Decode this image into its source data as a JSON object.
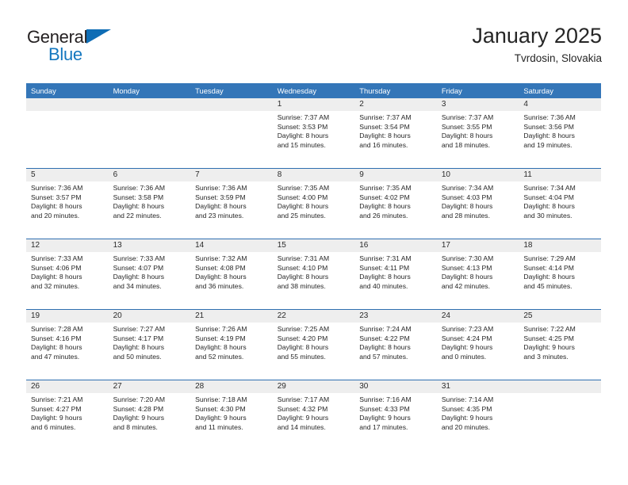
{
  "brand": {
    "name_top": "General",
    "name_bottom": "Blue",
    "triangle_color": "#0f6db5",
    "text_color_top": "#231f20",
    "text_color_bottom": "#1477bf"
  },
  "header": {
    "title": "January 2025",
    "subtitle": "Tvrdosin, Slovakia"
  },
  "theme": {
    "header_blue": "#3476b8",
    "separator_blue": "#2f6fb0",
    "date_band_gray": "#eeeeee",
    "text_dark": "#262626"
  },
  "weekdays": [
    "Sunday",
    "Monday",
    "Tuesday",
    "Wednesday",
    "Thursday",
    "Friday",
    "Saturday"
  ],
  "weeks": [
    {
      "days": [
        {
          "num": "",
          "sunrise": "",
          "sunset": "",
          "daylight_l1": "",
          "daylight_l2": "",
          "empty": true
        },
        {
          "num": "",
          "sunrise": "",
          "sunset": "",
          "daylight_l1": "",
          "daylight_l2": "",
          "empty": true
        },
        {
          "num": "",
          "sunrise": "",
          "sunset": "",
          "daylight_l1": "",
          "daylight_l2": "",
          "empty": true
        },
        {
          "num": "1",
          "sunrise": "Sunrise: 7:37 AM",
          "sunset": "Sunset: 3:53 PM",
          "daylight_l1": "Daylight: 8 hours",
          "daylight_l2": "and 15 minutes.",
          "empty": false
        },
        {
          "num": "2",
          "sunrise": "Sunrise: 7:37 AM",
          "sunset": "Sunset: 3:54 PM",
          "daylight_l1": "Daylight: 8 hours",
          "daylight_l2": "and 16 minutes.",
          "empty": false
        },
        {
          "num": "3",
          "sunrise": "Sunrise: 7:37 AM",
          "sunset": "Sunset: 3:55 PM",
          "daylight_l1": "Daylight: 8 hours",
          "daylight_l2": "and 18 minutes.",
          "empty": false
        },
        {
          "num": "4",
          "sunrise": "Sunrise: 7:36 AM",
          "sunset": "Sunset: 3:56 PM",
          "daylight_l1": "Daylight: 8 hours",
          "daylight_l2": "and 19 minutes.",
          "empty": false
        }
      ]
    },
    {
      "days": [
        {
          "num": "5",
          "sunrise": "Sunrise: 7:36 AM",
          "sunset": "Sunset: 3:57 PM",
          "daylight_l1": "Daylight: 8 hours",
          "daylight_l2": "and 20 minutes.",
          "empty": false
        },
        {
          "num": "6",
          "sunrise": "Sunrise: 7:36 AM",
          "sunset": "Sunset: 3:58 PM",
          "daylight_l1": "Daylight: 8 hours",
          "daylight_l2": "and 22 minutes.",
          "empty": false
        },
        {
          "num": "7",
          "sunrise": "Sunrise: 7:36 AM",
          "sunset": "Sunset: 3:59 PM",
          "daylight_l1": "Daylight: 8 hours",
          "daylight_l2": "and 23 minutes.",
          "empty": false
        },
        {
          "num": "8",
          "sunrise": "Sunrise: 7:35 AM",
          "sunset": "Sunset: 4:00 PM",
          "daylight_l1": "Daylight: 8 hours",
          "daylight_l2": "and 25 minutes.",
          "empty": false
        },
        {
          "num": "9",
          "sunrise": "Sunrise: 7:35 AM",
          "sunset": "Sunset: 4:02 PM",
          "daylight_l1": "Daylight: 8 hours",
          "daylight_l2": "and 26 minutes.",
          "empty": false
        },
        {
          "num": "10",
          "sunrise": "Sunrise: 7:34 AM",
          "sunset": "Sunset: 4:03 PM",
          "daylight_l1": "Daylight: 8 hours",
          "daylight_l2": "and 28 minutes.",
          "empty": false
        },
        {
          "num": "11",
          "sunrise": "Sunrise: 7:34 AM",
          "sunset": "Sunset: 4:04 PM",
          "daylight_l1": "Daylight: 8 hours",
          "daylight_l2": "and 30 minutes.",
          "empty": false
        }
      ]
    },
    {
      "days": [
        {
          "num": "12",
          "sunrise": "Sunrise: 7:33 AM",
          "sunset": "Sunset: 4:06 PM",
          "daylight_l1": "Daylight: 8 hours",
          "daylight_l2": "and 32 minutes.",
          "empty": false
        },
        {
          "num": "13",
          "sunrise": "Sunrise: 7:33 AM",
          "sunset": "Sunset: 4:07 PM",
          "daylight_l1": "Daylight: 8 hours",
          "daylight_l2": "and 34 minutes.",
          "empty": false
        },
        {
          "num": "14",
          "sunrise": "Sunrise: 7:32 AM",
          "sunset": "Sunset: 4:08 PM",
          "daylight_l1": "Daylight: 8 hours",
          "daylight_l2": "and 36 minutes.",
          "empty": false
        },
        {
          "num": "15",
          "sunrise": "Sunrise: 7:31 AM",
          "sunset": "Sunset: 4:10 PM",
          "daylight_l1": "Daylight: 8 hours",
          "daylight_l2": "and 38 minutes.",
          "empty": false
        },
        {
          "num": "16",
          "sunrise": "Sunrise: 7:31 AM",
          "sunset": "Sunset: 4:11 PM",
          "daylight_l1": "Daylight: 8 hours",
          "daylight_l2": "and 40 minutes.",
          "empty": false
        },
        {
          "num": "17",
          "sunrise": "Sunrise: 7:30 AM",
          "sunset": "Sunset: 4:13 PM",
          "daylight_l1": "Daylight: 8 hours",
          "daylight_l2": "and 42 minutes.",
          "empty": false
        },
        {
          "num": "18",
          "sunrise": "Sunrise: 7:29 AM",
          "sunset": "Sunset: 4:14 PM",
          "daylight_l1": "Daylight: 8 hours",
          "daylight_l2": "and 45 minutes.",
          "empty": false
        }
      ]
    },
    {
      "days": [
        {
          "num": "19",
          "sunrise": "Sunrise: 7:28 AM",
          "sunset": "Sunset: 4:16 PM",
          "daylight_l1": "Daylight: 8 hours",
          "daylight_l2": "and 47 minutes.",
          "empty": false
        },
        {
          "num": "20",
          "sunrise": "Sunrise: 7:27 AM",
          "sunset": "Sunset: 4:17 PM",
          "daylight_l1": "Daylight: 8 hours",
          "daylight_l2": "and 50 minutes.",
          "empty": false
        },
        {
          "num": "21",
          "sunrise": "Sunrise: 7:26 AM",
          "sunset": "Sunset: 4:19 PM",
          "daylight_l1": "Daylight: 8 hours",
          "daylight_l2": "and 52 minutes.",
          "empty": false
        },
        {
          "num": "22",
          "sunrise": "Sunrise: 7:25 AM",
          "sunset": "Sunset: 4:20 PM",
          "daylight_l1": "Daylight: 8 hours",
          "daylight_l2": "and 55 minutes.",
          "empty": false
        },
        {
          "num": "23",
          "sunrise": "Sunrise: 7:24 AM",
          "sunset": "Sunset: 4:22 PM",
          "daylight_l1": "Daylight: 8 hours",
          "daylight_l2": "and 57 minutes.",
          "empty": false
        },
        {
          "num": "24",
          "sunrise": "Sunrise: 7:23 AM",
          "sunset": "Sunset: 4:24 PM",
          "daylight_l1": "Daylight: 9 hours",
          "daylight_l2": "and 0 minutes.",
          "empty": false
        },
        {
          "num": "25",
          "sunrise": "Sunrise: 7:22 AM",
          "sunset": "Sunset: 4:25 PM",
          "daylight_l1": "Daylight: 9 hours",
          "daylight_l2": "and 3 minutes.",
          "empty": false
        }
      ]
    },
    {
      "days": [
        {
          "num": "26",
          "sunrise": "Sunrise: 7:21 AM",
          "sunset": "Sunset: 4:27 PM",
          "daylight_l1": "Daylight: 9 hours",
          "daylight_l2": "and 6 minutes.",
          "empty": false
        },
        {
          "num": "27",
          "sunrise": "Sunrise: 7:20 AM",
          "sunset": "Sunset: 4:28 PM",
          "daylight_l1": "Daylight: 9 hours",
          "daylight_l2": "and 8 minutes.",
          "empty": false
        },
        {
          "num": "28",
          "sunrise": "Sunrise: 7:18 AM",
          "sunset": "Sunset: 4:30 PM",
          "daylight_l1": "Daylight: 9 hours",
          "daylight_l2": "and 11 minutes.",
          "empty": false
        },
        {
          "num": "29",
          "sunrise": "Sunrise: 7:17 AM",
          "sunset": "Sunset: 4:32 PM",
          "daylight_l1": "Daylight: 9 hours",
          "daylight_l2": "and 14 minutes.",
          "empty": false
        },
        {
          "num": "30",
          "sunrise": "Sunrise: 7:16 AM",
          "sunset": "Sunset: 4:33 PM",
          "daylight_l1": "Daylight: 9 hours",
          "daylight_l2": "and 17 minutes.",
          "empty": false
        },
        {
          "num": "31",
          "sunrise": "Sunrise: 7:14 AM",
          "sunset": "Sunset: 4:35 PM",
          "daylight_l1": "Daylight: 9 hours",
          "daylight_l2": "and 20 minutes.",
          "empty": false
        },
        {
          "num": "",
          "sunrise": "",
          "sunset": "",
          "daylight_l1": "",
          "daylight_l2": "",
          "empty": true
        }
      ]
    }
  ]
}
